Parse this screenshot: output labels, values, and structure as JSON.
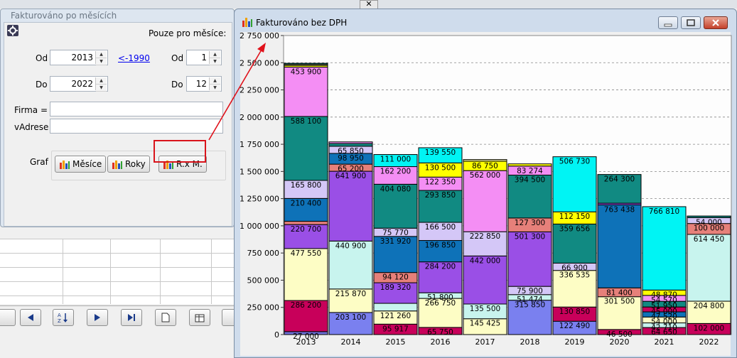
{
  "form_window": {
    "title": "Fakturováno po měsících",
    "months_only_label": "Pouze pro měsíce:",
    "from_label": "Od",
    "from_year": "2013",
    "link_1990": "<-1990",
    "from_month_label": "Od",
    "from_month": "1",
    "to_label": "Do",
    "to_year": "2022",
    "to_month_label": "Do",
    "to_month": "12",
    "firm_label": "Firma =",
    "firm_value": "",
    "address_label": "vAdrese",
    "address_value": "",
    "graph_label": "Graf",
    "btn_months": "Měsíce",
    "btn_years": "Roky",
    "btn_rxm": "R.x M."
  },
  "top_close": "✕",
  "chart_window": {
    "title": "Fakturováno bez DPH"
  },
  "chart_data": {
    "type": "bar",
    "stacked": true,
    "categories": [
      "2013",
      "2014",
      "2015",
      "2016",
      "2017",
      "2018",
      "2019",
      "2020",
      "2021",
      "2022"
    ],
    "ylim": [
      0,
      2750000
    ],
    "yticks": [
      "0",
      "250 000",
      "500 000",
      "750 000",
      "1 000 000",
      "1 250 000",
      "1 500 000",
      "1 750 000",
      "2 000 000",
      "2 250 000",
      "2 500 000",
      "2 750 000"
    ],
    "grid": true,
    "bars": [
      {
        "year": "2013",
        "segments": [
          {
            "v": 27000,
            "c": "#6f6fd9",
            "label": "27 000"
          },
          {
            "v": 286200,
            "c": "#c8005a",
            "label": "286 200"
          },
          {
            "v": 477550,
            "c": "#fdfdc5",
            "label": "477 550"
          },
          {
            "v": 220700,
            "c": "#9a4fe6",
            "label": "220 700"
          },
          {
            "v": 30000,
            "c": "#e6807a",
            "label": ""
          },
          {
            "v": 210400,
            "c": "#0e72b8",
            "label": "210 400"
          },
          {
            "v": 165800,
            "c": "#d4c7f7",
            "label": "165 800"
          },
          {
            "v": 588100,
            "c": "#118a82",
            "label": "588 100"
          },
          {
            "v": 453900,
            "c": "#f48ef4",
            "label": "453 900"
          },
          {
            "v": 15000,
            "c": "#ffff00",
            "label": ""
          },
          {
            "v": 10000,
            "c": "#f4f4a0",
            "label": ""
          },
          {
            "v": 10000,
            "c": "#118a82",
            "label": ""
          }
        ]
      },
      {
        "year": "2014",
        "segments": [
          {
            "v": 203100,
            "c": "#7a80ef",
            "label": "203 100"
          },
          {
            "v": 215870,
            "c": "#fdfdc5",
            "label": "215 870"
          },
          {
            "v": 440900,
            "c": "#c8f4ee",
            "label": "440 900"
          },
          {
            "v": 641900,
            "c": "#9a4fe6",
            "label": "641 900"
          },
          {
            "v": 65200,
            "c": "#e6807a",
            "label": "65 200"
          },
          {
            "v": 98950,
            "c": "#0e72b8",
            "label": "98 950"
          },
          {
            "v": 65850,
            "c": "#d4c7f7",
            "label": "65 850"
          },
          {
            "v": 25000,
            "c": "#118a82",
            "label": ""
          },
          {
            "v": 15000,
            "c": "#f48ef4",
            "label": ""
          }
        ]
      },
      {
        "year": "2015",
        "segments": [
          {
            "v": 95917,
            "c": "#c8005a",
            "label": "95 917"
          },
          {
            "v": 121260,
            "c": "#fdfdc5",
            "label": "121 260"
          },
          {
            "v": 70000,
            "c": "#c8f4ee",
            "label": ""
          },
          {
            "v": 189320,
            "c": "#9a4fe6",
            "label": "189 320"
          },
          {
            "v": 94120,
            "c": "#e6807a",
            "label": "94 120"
          },
          {
            "v": 331920,
            "c": "#0e72b8",
            "label": "331 920"
          },
          {
            "v": 75770,
            "c": "#d4c7f7",
            "label": "75 770"
          },
          {
            "v": 404080,
            "c": "#118a82",
            "label": "404 080"
          },
          {
            "v": 162200,
            "c": "#f48ef4",
            "label": "162 200"
          },
          {
            "v": 111000,
            "c": "#00f4f4",
            "label": "111 000"
          }
        ]
      },
      {
        "year": "2016",
        "segments": [
          {
            "v": 65750,
            "c": "#c8005a",
            "label": "65 750"
          },
          {
            "v": 266750,
            "c": "#fdfdc5",
            "label": "266 750"
          },
          {
            "v": 51800,
            "c": "#c8f4ee",
            "label": "51 800"
          },
          {
            "v": 284200,
            "c": "#9a4fe6",
            "label": "284 200"
          },
          {
            "v": 196850,
            "c": "#0e72b8",
            "label": "196 850"
          },
          {
            "v": 166500,
            "c": "#d4c7f7",
            "label": "166 500"
          },
          {
            "v": 293850,
            "c": "#118a82",
            "label": "293 850"
          },
          {
            "v": 122350,
            "c": "#f48ef4",
            "label": "122 350"
          },
          {
            "v": 130500,
            "c": "#ffff00",
            "label": "130 500"
          },
          {
            "v": 139550,
            "c": "#00f4f4",
            "label": "139 550"
          }
        ]
      },
      {
        "year": "2017",
        "segments": [
          {
            "v": 145425,
            "c": "#fdfdc5",
            "label": "145 425"
          },
          {
            "v": 135500,
            "c": "#c8f4ee",
            "label": "135 500"
          },
          {
            "v": 442000,
            "c": "#9a4fe6",
            "label": "442 000"
          },
          {
            "v": 222850,
            "c": "#d4c7f7",
            "label": "222 850"
          },
          {
            "v": 562000,
            "c": "#f48ef4",
            "label": "562 000"
          },
          {
            "v": 86750,
            "c": "#ffff00",
            "label": "86 750"
          },
          {
            "v": 15000,
            "c": "#f4f4a0",
            "label": ""
          }
        ]
      },
      {
        "year": "2018",
        "segments": [
          {
            "v": 315850,
            "c": "#7a80ef",
            "label": "315 850"
          },
          {
            "v": 51474,
            "c": "#c8f4ee",
            "label": "51 474"
          },
          {
            "v": 75900,
            "c": "#d4c7f7",
            "label": "75 900"
          },
          {
            "v": 501300,
            "c": "#9a4fe6",
            "label": "501 300"
          },
          {
            "v": 127300,
            "c": "#e6807a",
            "label": "127 300"
          },
          {
            "v": 394500,
            "c": "#118a82",
            "label": "394 500"
          },
          {
            "v": 83274,
            "c": "#f48ef4",
            "label": "83 274"
          },
          {
            "v": 20000,
            "c": "#ffff00",
            "label": ""
          }
        ]
      },
      {
        "year": "2019",
        "segments": [
          {
            "v": 122490,
            "c": "#7a80ef",
            "label": "122 490"
          },
          {
            "v": 130850,
            "c": "#c8005a",
            "label": "130 850"
          },
          {
            "v": 336535,
            "c": "#fdfdc5",
            "label": "336 535"
          },
          {
            "v": 66900,
            "c": "#d4c7f7",
            "label": "66 900"
          },
          {
            "v": 359656,
            "c": "#118a82",
            "label": "359 656"
          },
          {
            "v": 112150,
            "c": "#ffff00",
            "label": "112 150"
          },
          {
            "v": 506730,
            "c": "#00f4f4",
            "label": "506 730"
          }
        ]
      },
      {
        "year": "2020",
        "segments": [
          {
            "v": 46500,
            "c": "#c8005a",
            "label": "46 500"
          },
          {
            "v": 301500,
            "c": "#fdfdc5",
            "label": "301 500"
          },
          {
            "v": 81400,
            "c": "#e6807a",
            "label": "81 400"
          },
          {
            "v": 763438,
            "c": "#0e72b8",
            "label": "763 438"
          },
          {
            "v": 15000,
            "c": "#9a4fe6",
            "label": ""
          },
          {
            "v": 264300,
            "c": "#118a82",
            "label": "264 300"
          }
        ]
      },
      {
        "year": "2021",
        "segments": [
          {
            "v": 64650,
            "c": "#c8005a",
            "label": "64 650"
          },
          {
            "v": 42710,
            "c": "#c8f4ee",
            "label": "42 710"
          },
          {
            "v": 54000,
            "c": "#fdfdc5",
            "label": "54 000"
          },
          {
            "v": 47520,
            "c": "#0e72b8",
            "label": "47 520"
          },
          {
            "v": 45000,
            "c": "#c8005a",
            "label": "45 000"
          },
          {
            "v": 51950,
            "c": "#118a82",
            "label": "51 950"
          },
          {
            "v": 54570,
            "c": "#f48ef4",
            "label": "54 570"
          },
          {
            "v": 48870,
            "c": "#ffff00",
            "label": "48 870"
          },
          {
            "v": 766810,
            "c": "#00f4f4",
            "label": "766 810"
          }
        ]
      },
      {
        "year": "2022",
        "segments": [
          {
            "v": 102000,
            "c": "#c8005a",
            "label": "102 000"
          },
          {
            "v": 204800,
            "c": "#fdfdc5",
            "label": "204 800"
          },
          {
            "v": 614450,
            "c": "#c8f4ee",
            "label": "614 450"
          },
          {
            "v": 100000,
            "c": "#e6807a",
            "label": "100 000"
          },
          {
            "v": 54000,
            "c": "#d4c7f7",
            "label": "54 000"
          },
          {
            "v": 15000,
            "c": "#118a82",
            "label": ""
          }
        ]
      }
    ]
  },
  "colors": {
    "accent_red": "#d9141b",
    "window_frame": "#cfdcec"
  }
}
